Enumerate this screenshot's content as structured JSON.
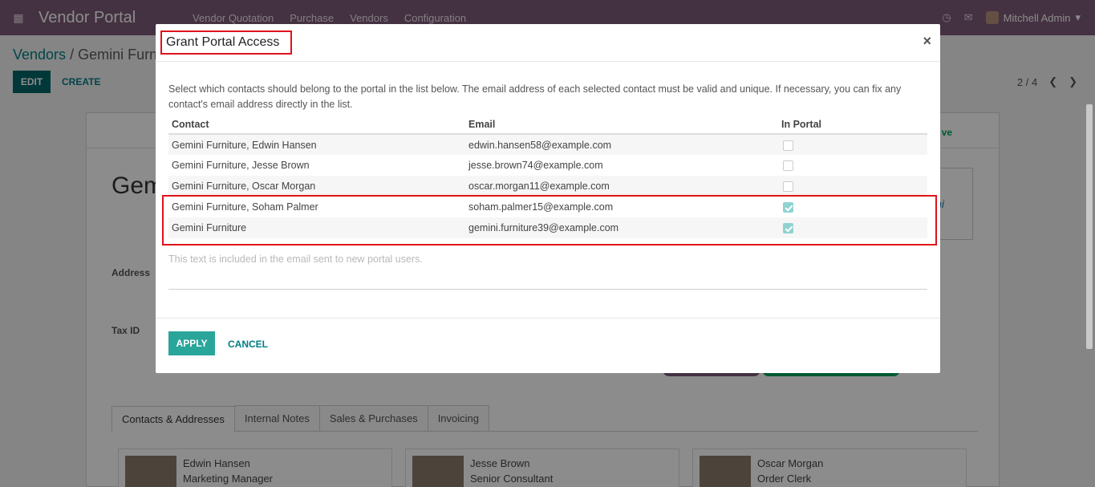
{
  "navbar": {
    "app_title": "Vendor Portal",
    "menu": [
      "Vendor Quotation",
      "Purchase",
      "Vendors",
      "Configuration"
    ],
    "user": "Mitchell Admin",
    "icons": [
      "apps-grid-icon",
      "clock-icon",
      "chat-icon",
      "caret-down-icon"
    ]
  },
  "control": {
    "breadcrumb_root": "Vendors",
    "breadcrumb_sep": "/",
    "breadcrumb_current": "Gemini Furn",
    "edit_label": "EDIT",
    "create_label": "CREATE",
    "pager": "2 / 4"
  },
  "sheet": {
    "title": "Gem",
    "active_label": "ve",
    "logo_text": "ini",
    "address_label": "Address",
    "tax_label": "Tax ID",
    "tabs": [
      "Contacts & Addresses",
      "Internal Notes",
      "Sales & Purchases",
      "Invoicing"
    ],
    "cards": [
      {
        "name": "Edwin Hansen",
        "role": "Marketing Manager"
      },
      {
        "name": "Jesse Brown",
        "role": "Senior Consultant"
      },
      {
        "name": "Oscar Morgan",
        "role": "Order Clerk"
      }
    ]
  },
  "modal": {
    "title": "Grant Portal Access",
    "close": "×",
    "description": "Select which contacts should belong to the portal in the list below. The email address of each selected contact must be valid and unique. If necessary, you can fix any contact's email address directly in the list.",
    "columns": {
      "contact": "Contact",
      "email": "Email",
      "in_portal": "In Portal"
    },
    "rows": [
      {
        "contact": "Gemini Furniture, Edwin Hansen",
        "email": "edwin.hansen58@example.com",
        "in_portal": false
      },
      {
        "contact": "Gemini Furniture, Jesse Brown",
        "email": "jesse.brown74@example.com",
        "in_portal": false
      },
      {
        "contact": "Gemini Furniture, Oscar Morgan",
        "email": "oscar.morgan11@example.com",
        "in_portal": false
      },
      {
        "contact": "Gemini Furniture, Soham Palmer",
        "email": "soham.palmer15@example.com",
        "in_portal": true
      },
      {
        "contact": "Gemini Furniture",
        "email": "gemini.furniture39@example.com",
        "in_portal": true
      }
    ],
    "note_placeholder": "This text is included in the email sent to new portal users.",
    "apply_label": "APPLY",
    "cancel_label": "CANCEL"
  },
  "colors": {
    "navbar": "#7c5a77",
    "primary": "#01666b",
    "apply": "#2aa59a",
    "highlight": "#e0121a",
    "checked": "#8fd3d1"
  }
}
